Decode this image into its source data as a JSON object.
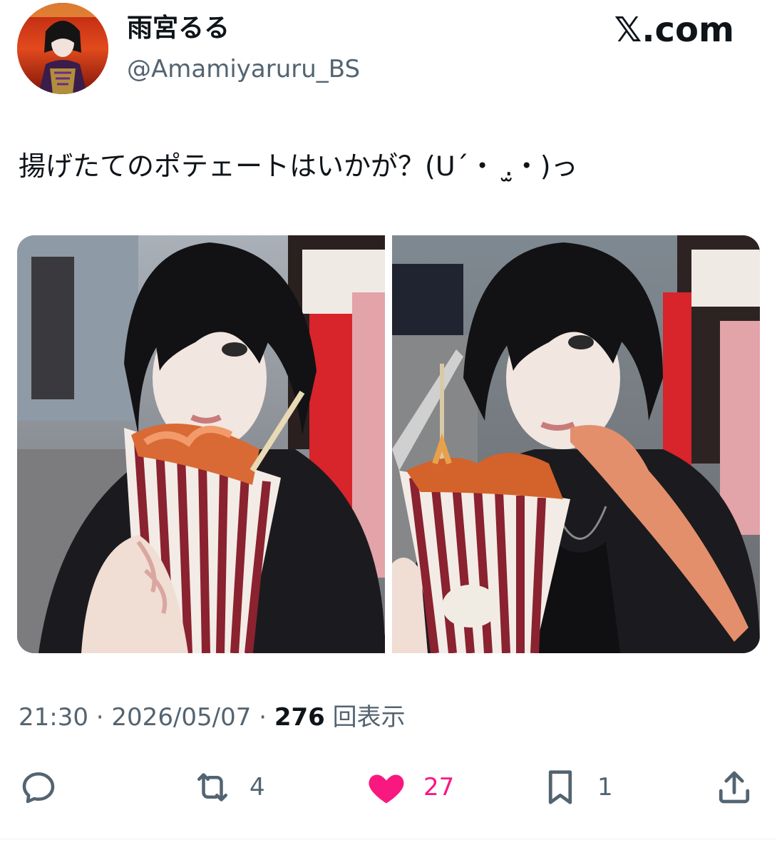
{
  "author": {
    "display_name": "雨宮るる",
    "handle": "@Amamiyaruru_BS",
    "avatar_icon": "avatar-photo"
  },
  "brand": "𝕏.com",
  "tweet": {
    "text": "揚げたてのポテェートはいかが？(ᑌ´・ .̫・)っ"
  },
  "media": {
    "photos": [
      {
        "icon": "photo-fries-1"
      },
      {
        "icon": "photo-fries-2"
      }
    ]
  },
  "meta": {
    "time": "21:30",
    "separator1": " · ",
    "date": "2026/05/07",
    "separator2": " · ",
    "views_count": "276",
    "views_label": " 回表示"
  },
  "actions": {
    "reply": {
      "icon": "reply-icon",
      "count": ""
    },
    "retweet": {
      "icon": "retweet-icon",
      "count": "4"
    },
    "like": {
      "icon": "heart-icon",
      "count": "27"
    },
    "bookmark": {
      "icon": "bookmark-icon",
      "count": "1"
    },
    "share": {
      "icon": "share-icon",
      "count": ""
    }
  },
  "colors": {
    "text_primary": "#0f1419",
    "text_secondary": "#536471",
    "like": "#f91880",
    "divider": "#eff3f4"
  }
}
